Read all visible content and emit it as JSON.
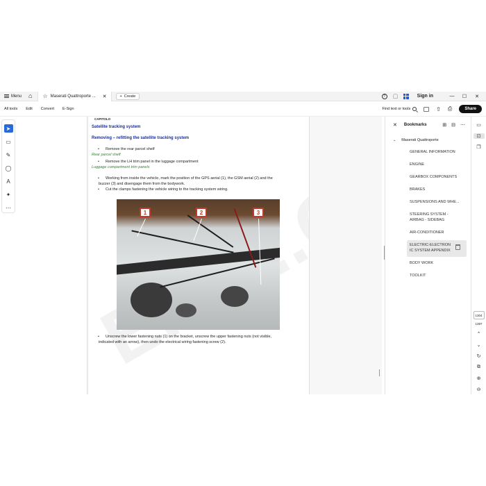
{
  "tabbar": {
    "menu_label": "Menu",
    "tab_title": "Maserati Quattroporte ...",
    "create_label": "Create",
    "sign_in": "Sign in"
  },
  "menubar": {
    "items": [
      "All tools",
      "Edit",
      "Convert",
      "E-Sign"
    ],
    "find_label": "Find text or tools",
    "share_label": "Share"
  },
  "document": {
    "header": "CAPITOLO",
    "title": "Satellite tracking system",
    "subtitle": "Removing – refitting the satellite tracking system",
    "bullet1": "Remove the rear parcel shelf",
    "link1": "Rear parcel shelf",
    "bullet2": "Remove the LH trim panel in the luggage compartment",
    "link2": "Luggage compartment trim panels",
    "bullet3_line1": "Working from inside the vehicle, mark the position of the GPS aerial (1), the GSM aerial (2) and the",
    "bullet3_line2": "buzzer (3) and disengage them from the bodywork.",
    "bullet4": "Cut the clamps fastening the vehicle wiring to the tracking system wiring.",
    "photo_labels": [
      "1",
      "2",
      "3"
    ],
    "bullet5_line1": "Unscrew the lower fastening nuts (1) on the bracket, unscrew the upper fastening nuts (not visible,",
    "bullet5_line2": "indicated with an arrow), then undo the electrical wiring fastening screw (2).",
    "watermark": "EPC...COM"
  },
  "bookmarks": {
    "title": "Bookmarks",
    "root": "Maserati Quattroporte",
    "items": [
      "GENERAL INFORMATION",
      "ENGINE",
      "GEARBOX COMPONENTS",
      "BRAKES",
      "SUSPENSIONS AND WHE...",
      "STEERING SYSTEM -",
      "AIRBAG - SIDEBAG",
      "AIR-CONDITIONER",
      "ELECTRIC-ELECTRON",
      "IC SYSTEM APPENDIX",
      "BODY WORK",
      "TOOLKIT"
    ]
  },
  "pager": {
    "current": "1304",
    "total": "1397"
  }
}
